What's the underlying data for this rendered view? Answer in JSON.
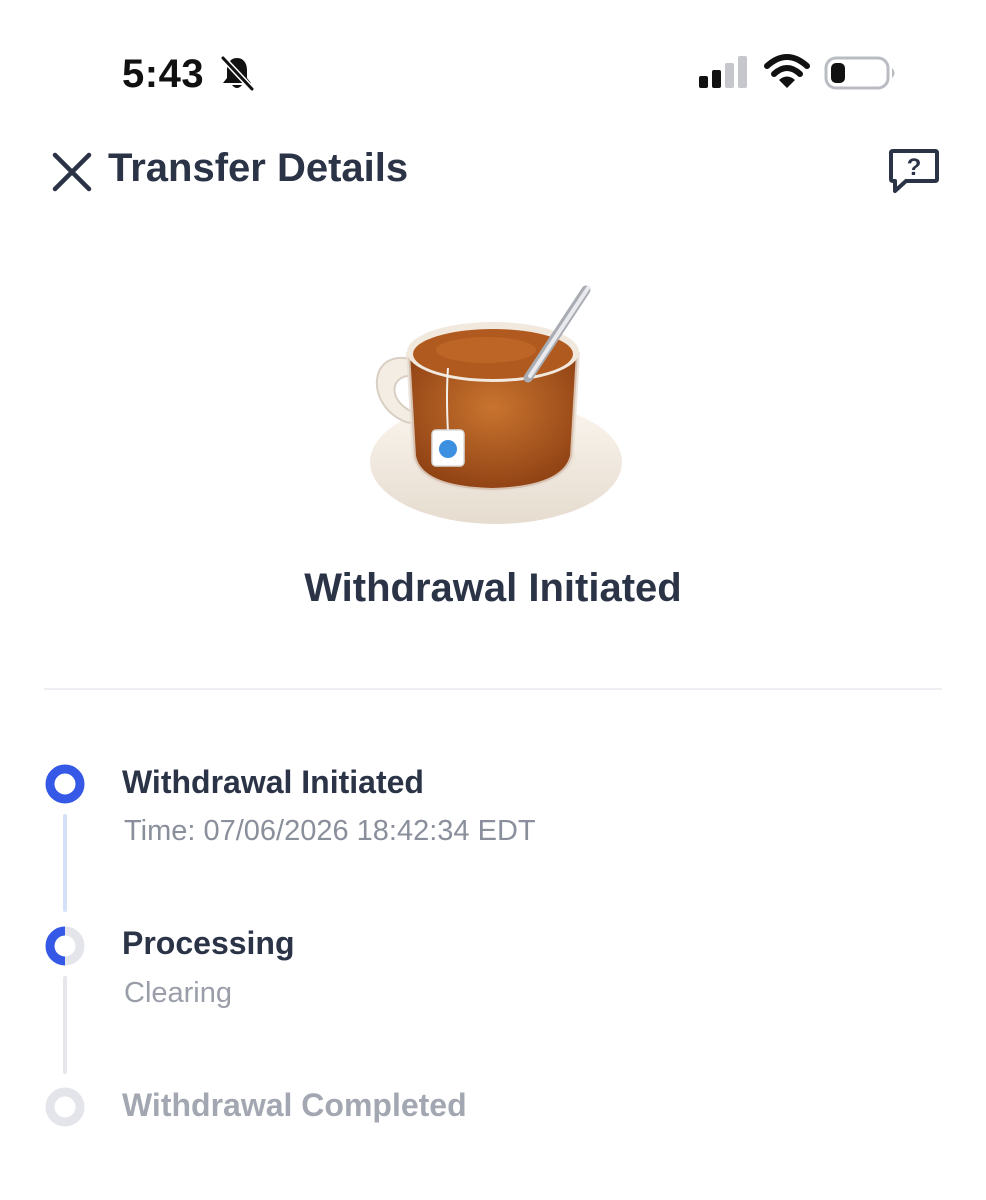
{
  "status_bar": {
    "time": "5:43",
    "icons": [
      "bell-slash-icon",
      "cellular-signal-icon",
      "wifi-icon",
      "battery-low-icon"
    ]
  },
  "header": {
    "title": "Transfer Details",
    "close_icon": "close-icon",
    "help_icon": "help-chat-icon"
  },
  "hero": {
    "illustration": "tea-cup-illustration",
    "status": "Withdrawal Initiated"
  },
  "timeline": {
    "steps": [
      {
        "title": "Withdrawal Initiated",
        "subtitle": "Time: 07/06/2026 18:42:34 EDT",
        "state": "complete"
      },
      {
        "title": "Processing",
        "subtitle": "Clearing",
        "state": "in-progress"
      },
      {
        "title": "Withdrawal Completed",
        "subtitle": "",
        "state": "pending"
      }
    ]
  },
  "colors": {
    "accent": "#3558e6",
    "text_dark": "#2b3347",
    "text_muted": "#8a8f9c",
    "text_disabled": "#a3a7b1",
    "track_done": "#d6e0f8",
    "track_pending": "#e6e7ea",
    "divider": "#eceef2"
  }
}
